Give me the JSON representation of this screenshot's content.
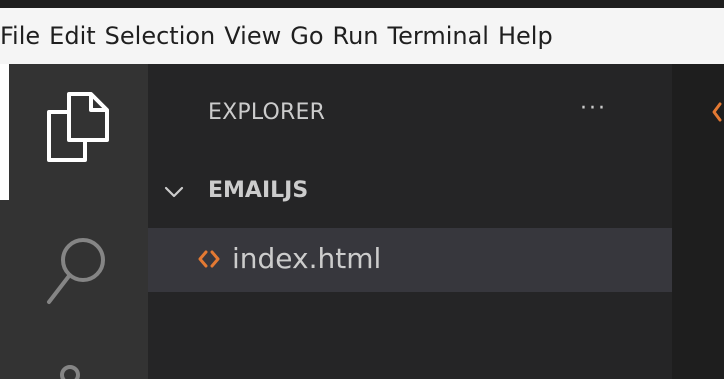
{
  "menubar": {
    "items": [
      "File",
      "Edit",
      "Selection",
      "View",
      "Go",
      "Run",
      "Terminal",
      "Help"
    ]
  },
  "activity_bar": {
    "icons": [
      "explorer-files-icon",
      "search-icon",
      "source-control-icon"
    ]
  },
  "sidebar": {
    "title": "EXPLORER",
    "more_actions": "···",
    "folder": {
      "name": "EMAILJS",
      "expanded": true,
      "files": [
        {
          "name": "index.html",
          "icon": "html-file-icon",
          "selected": true
        }
      ]
    }
  },
  "colors": {
    "activity_bar_bg": "#333333",
    "sidebar_bg": "#252526",
    "selected_row_bg": "#37373d",
    "editor_bg": "#1e1e1e",
    "html_icon": "#e37933",
    "text": "#cccccc"
  }
}
